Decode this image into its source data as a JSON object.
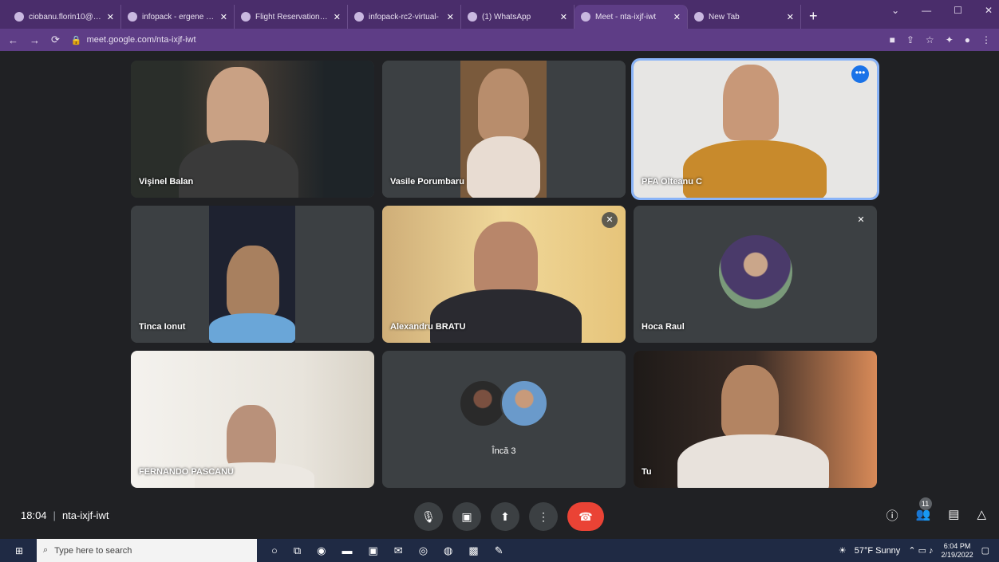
{
  "browser": {
    "tabs": [
      {
        "label": "ciobanu.florin10@yah",
        "active": false
      },
      {
        "label": "infopack - ergene net",
        "active": false
      },
      {
        "label": "Flight Reservation Flo",
        "active": false
      },
      {
        "label": "infopack-rc2-virtual-",
        "active": false
      },
      {
        "label": "(1) WhatsApp",
        "active": false
      },
      {
        "label": "Meet - nta-ixjf-iwt",
        "active": true
      },
      {
        "label": "New Tab",
        "active": false
      }
    ],
    "url": "meet.google.com/nta-ixjf-iwt"
  },
  "participants": [
    {
      "name": "Vişinel Balan",
      "speaking": false,
      "muted": false
    },
    {
      "name": "Vasile Porumbaru",
      "speaking": false,
      "muted": false
    },
    {
      "name": "PFA Olteanu C",
      "speaking": true,
      "muted": false
    },
    {
      "name": "Tinca Ionut",
      "speaking": false,
      "muted": false
    },
    {
      "name": "Alexandru BRATU",
      "speaking": false,
      "muted": true
    },
    {
      "name": "Hoca Raul",
      "speaking": false,
      "muted": true
    },
    {
      "name": "FERNANDO PASCANU",
      "speaking": false,
      "muted": false
    },
    {
      "name": "Încă 3",
      "speaking": false,
      "muted": false
    },
    {
      "name": "Tu",
      "speaking": false,
      "muted": false
    }
  ],
  "meeting": {
    "time": "18:04",
    "code": "nta-ixjf-iwt",
    "participant_count": "11"
  },
  "taskbar": {
    "search_placeholder": "Type here to search",
    "weather": "57°F  Sunny",
    "time": "6:04 PM",
    "date": "2/19/2022"
  }
}
